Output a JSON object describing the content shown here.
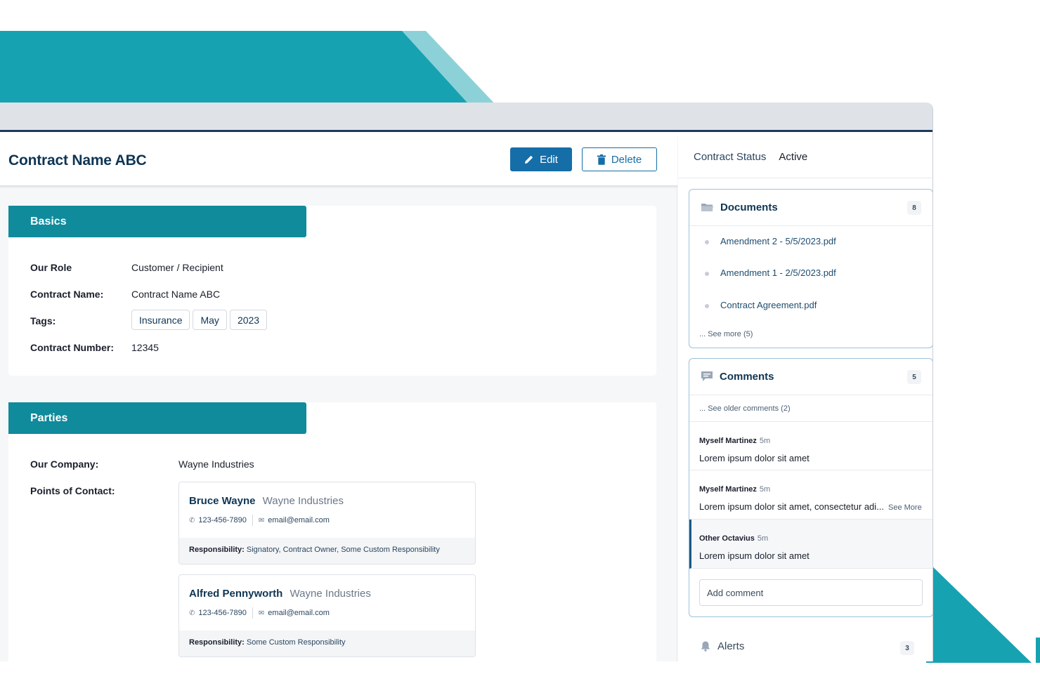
{
  "colors": {
    "accent_teal": "#0f8b9c",
    "deco_teal": "#17a2b2",
    "deco_light_teal": "#8dd1d8",
    "primary_blue": "#156ea8",
    "title_navy": "#0f3554"
  },
  "header": {
    "title": "Contract Name ABC",
    "edit_label": "Edit",
    "edit_icon": "pencil-icon",
    "delete_label": "Delete",
    "delete_icon": "trash-icon"
  },
  "basics": {
    "section_title": "Basics",
    "fields": [
      {
        "label": "Our Role",
        "value": "Customer / Recipient"
      },
      {
        "label": "Contract Name:",
        "value": "Contract Name ABC"
      },
      {
        "label": "Tags:",
        "value": ""
      },
      {
        "label": "Contract Number:",
        "value": "12345"
      }
    ],
    "tags": [
      "Insurance",
      "May",
      "2023"
    ]
  },
  "parties": {
    "section_title": "Parties",
    "our_company_label": "Our Company:",
    "our_company_value": "Wayne Industries",
    "points_of_contact_label": "Points of Contact:",
    "contacts": [
      {
        "name": "Bruce Wayne",
        "company": "Wayne Industries",
        "phone": "123-456-7890",
        "email": "email@email.com",
        "responsibility_label": "Responsibility:",
        "responsibility": "Signatory, Contract Owner, Some Custom Responsibility"
      },
      {
        "name": "Alfred Pennyworth",
        "company": "Wayne Industries",
        "phone": "123-456-7890",
        "email": "email@email.com",
        "responsibility_label": "Responsibility:",
        "responsibility": "Some Custom Responsibility"
      }
    ]
  },
  "sidebar": {
    "status_label": "Contract Status",
    "status_value": "Active",
    "documents": {
      "title": "Documents",
      "icon": "folder-icon",
      "count": "8",
      "items": [
        "Amendment 2 - 5/5/2023.pdf",
        "Amendment 1 - 2/5/2023.pdf",
        "Contract Agreement.pdf"
      ],
      "see_more": "... See more (5)"
    },
    "comments": {
      "title": "Comments",
      "icon": "comment-icon",
      "count": "5",
      "see_older": "... See older comments (2)",
      "items": [
        {
          "author": "Myself Martinez",
          "time": "5m",
          "body": "Lorem ipsum dolor sit amet",
          "more": ""
        },
        {
          "author": "Myself Martinez",
          "time": "5m",
          "body": "Lorem ipsum dolor sit amet, consectetur adi...",
          "more": "See More"
        },
        {
          "author": "Other Octavius",
          "time": "5m",
          "body": "Lorem ipsum dolor sit amet",
          "more": ""
        }
      ],
      "add_placeholder": "Add comment"
    },
    "alerts": {
      "title": "Alerts",
      "icon": "bell-icon",
      "count": "3"
    }
  }
}
